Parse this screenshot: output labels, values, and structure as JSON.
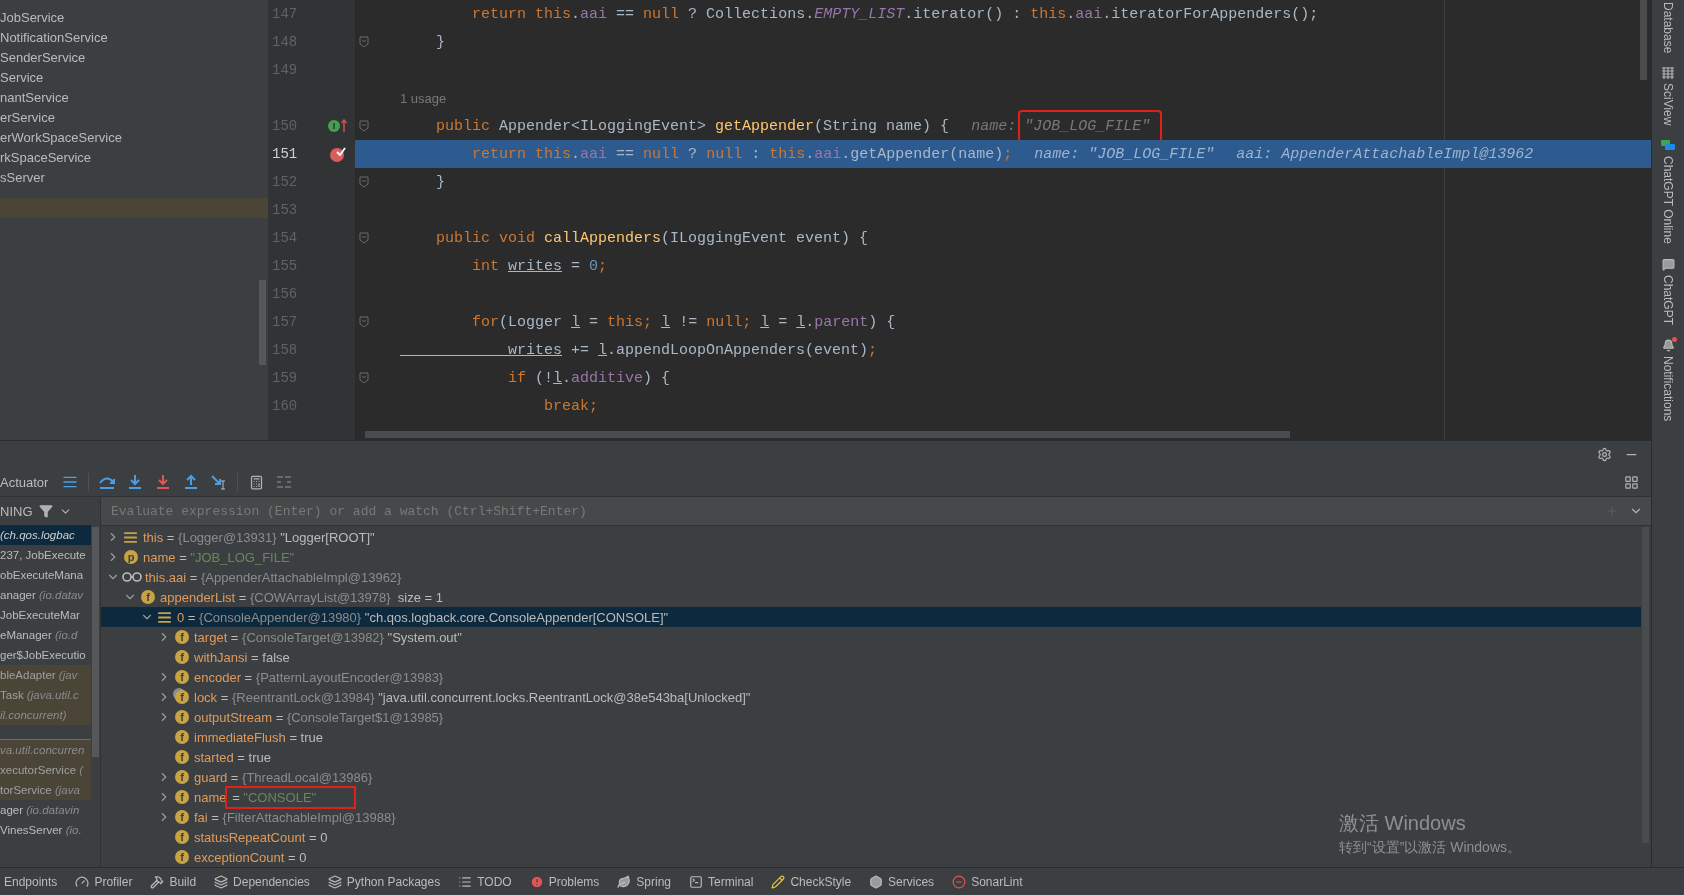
{
  "project_panel": {
    "items": [
      "JobService",
      "NotificationService",
      "SenderService",
      "Service",
      "nantService",
      "erService",
      "erWorkSpaceService",
      "rkSpaceService",
      "sServer"
    ]
  },
  "editor": {
    "lines": [
      {
        "kind": "code",
        "number": "147",
        "current": false,
        "fold": false,
        "tokens": [
          {
            "text": "        return",
            "kind": "kw"
          },
          {
            "text": " this",
            "kind": "kw"
          },
          {
            "text": ".",
            "kind": "plain"
          },
          {
            "text": "aai",
            "kind": "field"
          },
          {
            "text": " == ",
            "kind": "plain"
          },
          {
            "text": "null",
            "kind": "kw"
          },
          {
            "text": " ? Collections.",
            "kind": "plain"
          },
          {
            "text": "EMPTY_LIST",
            "kind": "static"
          },
          {
            "text": ".iterator() : ",
            "kind": "plain"
          },
          {
            "text": "this",
            "kind": "kw"
          },
          {
            "text": ".",
            "kind": "plain"
          },
          {
            "text": "aai",
            "kind": "field"
          },
          {
            "text": ".iteratorForAppenders();",
            "kind": "plain"
          }
        ]
      },
      {
        "kind": "code",
        "number": "148",
        "current": false,
        "fold": true,
        "tokens": [
          {
            "text": "    }",
            "kind": "plain"
          }
        ]
      },
      {
        "kind": "code",
        "number": "149",
        "current": false,
        "fold": false
      },
      {
        "kind": "usage",
        "text": "1 usage"
      },
      {
        "kind": "code",
        "number": "150",
        "current": false,
        "fold": true,
        "gutter": {
          "kind": "implements",
          "letter": "I"
        },
        "tokens": [
          {
            "text": "    public",
            "kind": "kw"
          },
          {
            "text": " Appender<ILoggingEvent> ",
            "kind": "plain"
          },
          {
            "text": "getAppender",
            "kind": "method"
          },
          {
            "text": "(String name) {",
            "kind": "plain"
          }
        ],
        "hints": [
          {
            "label": "name:",
            "value": "\"JOB_LOG_FILE\"",
            "boxed": true
          }
        ]
      },
      {
        "kind": "code",
        "number": "151",
        "current": true,
        "fold": false,
        "gutter": {
          "kind": "breakpoint"
        },
        "tokens": [
          {
            "text": "        return",
            "kind": "kw"
          },
          {
            "text": " this",
            "kind": "kw"
          },
          {
            "text": ".",
            "kind": "plain"
          },
          {
            "text": "aai",
            "kind": "field"
          },
          {
            "text": " == ",
            "kind": "plain"
          },
          {
            "text": "null",
            "kind": "kw"
          },
          {
            "text": " ? ",
            "kind": "plain"
          },
          {
            "text": "null",
            "kind": "kw"
          },
          {
            "text": " : ",
            "kind": "plain"
          },
          {
            "text": "this",
            "kind": "kw"
          },
          {
            "text": ".",
            "kind": "plain"
          },
          {
            "text": "aai",
            "kind": "field"
          },
          {
            "text": ".getAppender(name)",
            "kind": "plain"
          },
          {
            "text": ";",
            "kind": "kw"
          }
        ],
        "hints": [
          {
            "label": "name:",
            "value": "\"JOB_LOG_FILE\"",
            "boxed": false
          },
          {
            "label": "aai:",
            "value": "AppenderAttachableImpl@13962",
            "boxed": false
          }
        ]
      },
      {
        "kind": "code",
        "number": "152",
        "current": false,
        "fold": true,
        "tokens": [
          {
            "text": "    }",
            "kind": "plain"
          }
        ]
      },
      {
        "kind": "code",
        "number": "153",
        "current": false,
        "fold": false
      },
      {
        "kind": "code",
        "number": "154",
        "current": false,
        "fold": true,
        "tokens": [
          {
            "text": "    public void ",
            "kind": "kw"
          },
          {
            "text": "callAppenders",
            "kind": "method"
          },
          {
            "text": "(ILoggingEvent event) {",
            "kind": "plain"
          }
        ]
      },
      {
        "kind": "code",
        "number": "155",
        "current": false,
        "fold": false,
        "tokens": [
          {
            "text": "        int ",
            "kind": "kw"
          },
          {
            "text": "writes",
            "kind": "local"
          },
          {
            "text": " = ",
            "kind": "plain"
          },
          {
            "text": "0",
            "kind": "num"
          },
          {
            "text": ";",
            "kind": "kw"
          }
        ]
      },
      {
        "kind": "code",
        "number": "156",
        "current": false,
        "fold": false
      },
      {
        "kind": "code",
        "number": "157",
        "current": false,
        "fold": true,
        "tokens": [
          {
            "text": "        for",
            "kind": "kw"
          },
          {
            "text": "(Logger ",
            "kind": "plain"
          },
          {
            "text": "l",
            "kind": "local"
          },
          {
            "text": " = ",
            "kind": "plain"
          },
          {
            "text": "this",
            "kind": "kw"
          },
          {
            "text": "; ",
            "kind": "kw"
          },
          {
            "text": "l",
            "kind": "local"
          },
          {
            "text": " != ",
            "kind": "plain"
          },
          {
            "text": "null",
            "kind": "kw"
          },
          {
            "text": "; ",
            "kind": "kw"
          },
          {
            "text": "l",
            "kind": "local"
          },
          {
            "text": " = ",
            "kind": "plain"
          },
          {
            "text": "l",
            "kind": "local"
          },
          {
            "text": ".",
            "kind": "plain"
          },
          {
            "text": "parent",
            "kind": "field"
          },
          {
            "text": ") {",
            "kind": "plain"
          }
        ]
      },
      {
        "kind": "code",
        "number": "158",
        "current": false,
        "fold": false,
        "tokens": [
          {
            "text": "            writes",
            "kind": "local"
          },
          {
            "text": " += ",
            "kind": "plain"
          },
          {
            "text": "l",
            "kind": "local"
          },
          {
            "text": ".appendLoopOnAppenders(event)",
            "kind": "plain"
          },
          {
            "text": ";",
            "kind": "kw"
          }
        ]
      },
      {
        "kind": "code",
        "number": "159",
        "current": false,
        "fold": true,
        "tokens": [
          {
            "text": "            if",
            "kind": "kw"
          },
          {
            "text": " (!",
            "kind": "plain"
          },
          {
            "text": "l",
            "kind": "local"
          },
          {
            "text": ".",
            "kind": "plain"
          },
          {
            "text": "additive",
            "kind": "field"
          },
          {
            "text": ") {",
            "kind": "plain"
          }
        ]
      },
      {
        "kind": "code",
        "number": "160",
        "current": false,
        "fold": false,
        "tokens": [
          {
            "text": "                break",
            "kind": "kw"
          },
          {
            "text": ";",
            "kind": "kw"
          }
        ]
      }
    ]
  },
  "right_strip": [
    {
      "label": "Database",
      "kind": "plain"
    },
    {
      "label": "SciView",
      "kind": "grid"
    },
    {
      "label": "ChatGPT Online",
      "kind": "chat-color"
    },
    {
      "label": "ChatGPT",
      "kind": "chat"
    },
    {
      "label": "Notifications",
      "kind": "bell"
    }
  ],
  "debugger": {
    "title": "Actuator",
    "frames_header": "NING",
    "frames": [
      {
        "package": "(ch.qos.logbac",
        "selected": true,
        "library": false,
        "separator_before": false
      },
      {
        "name": "237, JobExecute",
        "selected": false,
        "library": false,
        "separator_before": false
      },
      {
        "name": "obExecuteMana",
        "selected": false,
        "library": false,
        "separator_before": false
      },
      {
        "name": "anager",
        "package": "(io.datav",
        "selected": false,
        "library": false,
        "separator_before": false
      },
      {
        "name": "JobExecuteMar",
        "selected": false,
        "library": false,
        "separator_before": false
      },
      {
        "name": "eManager",
        "package": "(io.d",
        "selected": false,
        "library": false,
        "separator_before": false
      },
      {
        "name": "ger$JobExecutio",
        "selected": false,
        "library": false,
        "separator_before": false
      },
      {
        "name": "bleAdapter",
        "package": "(jav",
        "selected": false,
        "library": true,
        "separator_before": false
      },
      {
        "name": "Task",
        "package": "(java.util.c",
        "selected": false,
        "library": true,
        "separator_before": false
      },
      {
        "package": "il.concurrent)",
        "selected": false,
        "library": true,
        "separator_before": false
      },
      {
        "package": "va.util.concurren",
        "selected": false,
        "library": true,
        "separator_before": true
      },
      {
        "name": "xecutorService",
        "package": "(",
        "selected": false,
        "library": true,
        "separator_before": false
      },
      {
        "name": "torService",
        "package": "(java",
        "selected": false,
        "library": true,
        "separator_before": false
      },
      {
        "name": "ager",
        "package": "(io.datavin",
        "selected": false,
        "library": false,
        "separator_before": false
      },
      {
        "name": "VinesServer",
        "package": "(io.",
        "selected": false,
        "library": false,
        "separator_before": false
      }
    ],
    "evaluate": {
      "placeholder": "Evaluate expression (Enter) or add a watch (Ctrl+Shift+Enter)"
    },
    "variables": [
      {
        "name": "this",
        "eq": "=",
        "kind": "lines",
        "expanded": false,
        "selected": false,
        "type": "{Logger@13931}",
        "value": "\"Logger[ROOT]\""
      },
      {
        "name": "name",
        "eq": "=",
        "kind": "param",
        "letter": "p",
        "expanded": false,
        "selected": false,
        "string": "\"JOB_LOG_FILE\""
      },
      {
        "name": "this.aai",
        "eq": "=",
        "kind": "watch",
        "expanded": true,
        "selected": false,
        "type": "{AppenderAttachableImpl@13962}",
        "children": [
          {
            "name": "appenderList",
            "eq": "=",
            "kind": "field",
            "letter": "f",
            "expanded": true,
            "selected": false,
            "type": "{COWArrayList@13978}",
            "extra": "size = 1",
            "children": [
              {
                "name": "0",
                "eq": "=",
                "kind": "lines",
                "expanded": true,
                "selected": true,
                "type": "{ConsoleAppender@13980}",
                "value": "\"ch.qos.logback.core.ConsoleAppender[CONSOLE]\"",
                "children": [
                  {
                    "name": "target",
                    "eq": "=",
                    "kind": "field",
                    "letter": "f",
                    "expanded": false,
                    "selected": false,
                    "type": "{ConsoleTarget@13982}",
                    "value": "\"System.out\""
                  },
                  {
                    "name": "withJansi",
                    "eq": "=",
                    "kind": "field",
                    "letter": "f",
                    "selected": false,
                    "value": "false"
                  },
                  {
                    "name": "encoder",
                    "eq": "=",
                    "kind": "field",
                    "letter": "f",
                    "expanded": false,
                    "selected": false,
                    "type": "{PatternLayoutEncoder@13983}"
                  },
                  {
                    "name": "lock",
                    "eq": "=",
                    "kind": "field-locked",
                    "letter": "f",
                    "expanded": false,
                    "selected": false,
                    "type": "{ReentrantLock@13984}",
                    "value": "\"java.util.concurrent.locks.ReentrantLock@38e543ba[Unlocked]\""
                  },
                  {
                    "name": "outputStream",
                    "eq": "=",
                    "kind": "field",
                    "letter": "f",
                    "expanded": false,
                    "selected": false,
                    "type": "{ConsoleTarget$1@13985}"
                  },
                  {
                    "name": "immediateFlush",
                    "eq": "=",
                    "kind": "field",
                    "letter": "f",
                    "selected": false,
                    "value": "true"
                  },
                  {
                    "name": "started",
                    "eq": "=",
                    "kind": "field",
                    "letter": "f",
                    "selected": false,
                    "value": "true"
                  },
                  {
                    "name": "guard",
                    "eq": "=",
                    "kind": "field",
                    "letter": "f",
                    "expanded": false,
                    "selected": false,
                    "type": "{ThreadLocal@13986}"
                  },
                  {
                    "name": "name",
                    "eq": "=",
                    "kind": "field",
                    "letter": "f",
                    "expanded": false,
                    "selected": false,
                    "string": "\"CONSOLE\"",
                    "boxed": true
                  },
                  {
                    "name": "fai",
                    "eq": "=",
                    "kind": "field",
                    "letter": "f",
                    "expanded": false,
                    "selected": false,
                    "type": "{FilterAttachableImpl@13988}"
                  },
                  {
                    "name": "statusRepeatCount",
                    "eq": "=",
                    "kind": "field",
                    "letter": "f",
                    "selected": false,
                    "value": "0"
                  },
                  {
                    "name": "exceptionCount",
                    "eq": "=",
                    "kind": "field",
                    "letter": "f",
                    "selected": false,
                    "value": "0"
                  }
                ]
              }
            ]
          }
        ]
      }
    ]
  },
  "os_notice": {
    "title": "激活 Windows",
    "text": "转到“设置”以激活 Windows。"
  },
  "bottom_bar": [
    {
      "label": "Endpoints",
      "kind": "plain"
    },
    {
      "label": "Profiler",
      "kind": "gauge"
    },
    {
      "label": "Build",
      "kind": "hammer"
    },
    {
      "label": "Dependencies",
      "kind": "layers"
    },
    {
      "label": "Python Packages",
      "kind": "layers"
    },
    {
      "label": "TODO",
      "kind": "list"
    },
    {
      "label": "Problems",
      "kind": "alert"
    },
    {
      "label": "Spring",
      "kind": "leaf"
    },
    {
      "label": "Terminal",
      "kind": "terminal"
    },
    {
      "label": "CheckStyle",
      "kind": "pencil"
    },
    {
      "label": "Services",
      "kind": "hexagon"
    },
    {
      "label": "SonarLint",
      "kind": "minus-circle"
    }
  ]
}
